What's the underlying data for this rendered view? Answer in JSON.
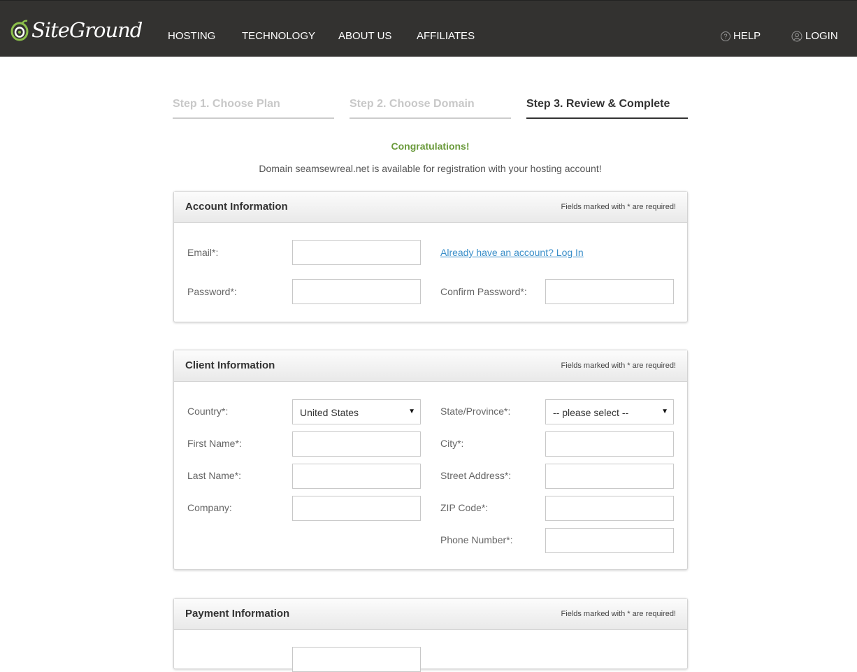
{
  "header": {
    "logo_text": "SiteGround",
    "nav": [
      "HOSTING",
      "TECHNOLOGY",
      "ABOUT US",
      "AFFILIATES"
    ],
    "help": "HELP",
    "login": "LOGIN"
  },
  "steps": [
    "Step 1. Choose Plan",
    "Step 2. Choose Domain",
    "Step 3. Review & Complete"
  ],
  "congrats": "Congratulations!",
  "availability": "Domain seamsewreal.net is available for registration with your hosting account!",
  "required_note": "Fields marked with * are required!",
  "account": {
    "title": "Account Information",
    "email_label": "Email*:",
    "login_link": "Already have an account? Log In",
    "password_label": "Password*:",
    "confirm_label": "Confirm Password*:"
  },
  "client": {
    "title": "Client Information",
    "country_label": "Country*:",
    "country_value": "United States",
    "state_label": "State/Province*:",
    "state_value": "-- please select --",
    "first_name_label": "First Name*:",
    "city_label": "City*:",
    "last_name_label": "Last Name*:",
    "street_label": "Street Address*:",
    "company_label": "Company:",
    "zip_label": "ZIP Code*:",
    "phone_label": "Phone Number*:"
  },
  "payment": {
    "title": "Payment Information"
  },
  "colors": {
    "header_bg": "#333230",
    "accent_green": "#6a9a3b",
    "link_blue": "#3b8fc9"
  }
}
